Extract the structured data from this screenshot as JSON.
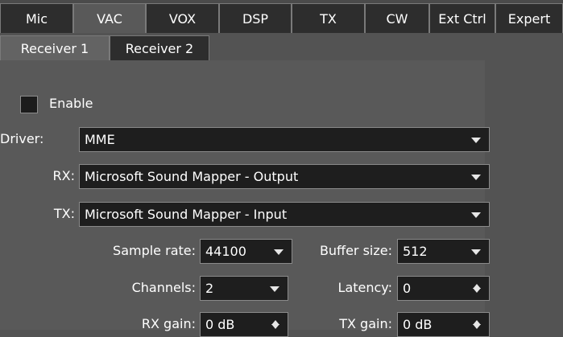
{
  "tabs": [
    {
      "label": "Mic"
    },
    {
      "label": "VAC"
    },
    {
      "label": "VOX"
    },
    {
      "label": "DSP"
    },
    {
      "label": "TX"
    },
    {
      "label": "CW"
    },
    {
      "label": "Ext Ctrl"
    },
    {
      "label": "Expert"
    }
  ],
  "active_tab": "VAC",
  "subtabs": [
    {
      "label": "Receiver 1"
    },
    {
      "label": "Receiver 2"
    }
  ],
  "active_subtab": "Receiver 1",
  "enable": {
    "label": "Enable",
    "checked": false
  },
  "driver": {
    "label": "Driver:",
    "value": "MME"
  },
  "rx": {
    "label": "RX:",
    "value": "Microsoft Sound Mapper - Output"
  },
  "tx": {
    "label": "TX:",
    "value": "Microsoft Sound Mapper - Input"
  },
  "sample_rate": {
    "label": "Sample rate:",
    "value": "44100"
  },
  "buffer_size": {
    "label": "Buffer size:",
    "value": "512"
  },
  "channels": {
    "label": "Channels:",
    "value": "2"
  },
  "latency": {
    "label": "Latency:",
    "value": "0"
  },
  "rx_gain": {
    "label": "RX gain:",
    "value": "0 dB"
  },
  "tx_gain": {
    "label": "TX gain:",
    "value": "0 dB"
  },
  "colors": {
    "background": "#535353",
    "panel": "#595959",
    "tab_inactive": "#2d2d2d",
    "field": "#1e1e1e",
    "text": "#ffffff"
  }
}
